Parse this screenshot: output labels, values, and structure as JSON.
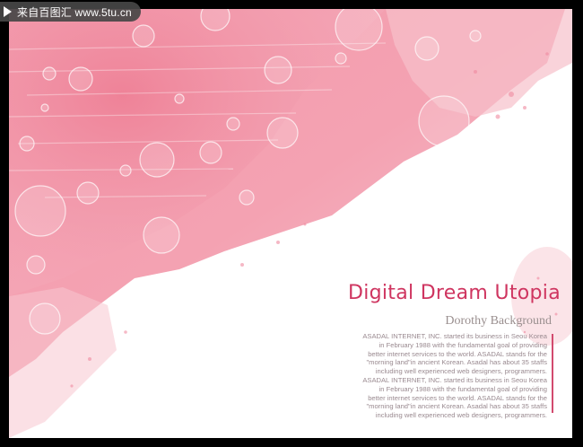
{
  "watermark": {
    "icon": "play-icon",
    "text": "来自百图汇 www.5tu.cn"
  },
  "poster": {
    "title": "Digital Dream Utopia",
    "subtitle": "Dorothy Background",
    "body_lines": [
      "ASADAL INTERNET, INC. started its business in Seou Korea",
      "in February 1988 with the fundamental goal of providing",
      "better internet services to the world. ASADAL stands for the",
      "\"morning land\"in ancient Korean. Asadal has about 35 staffs",
      "including well experienced web designers, programmers.",
      "ASADAL INTERNET, INC. started its business in Seou Korea",
      "in February 1988 with the fundamental goal of providing",
      "better internet services to the world. ASADAL stands for the",
      "\"morning land\"in ancient Korean. Asadal has about 35 staffs",
      "including well experienced web designers, programmers."
    ]
  },
  "colors": {
    "frame": "#000000",
    "background": "#ffffff",
    "pink_main": "#f08aa0",
    "pink_light": "#f7b8c4",
    "title": "#cf3560",
    "subtitle": "#9a8f8f",
    "body": "#9a8a90",
    "accent_bar": "#d24a6e"
  }
}
